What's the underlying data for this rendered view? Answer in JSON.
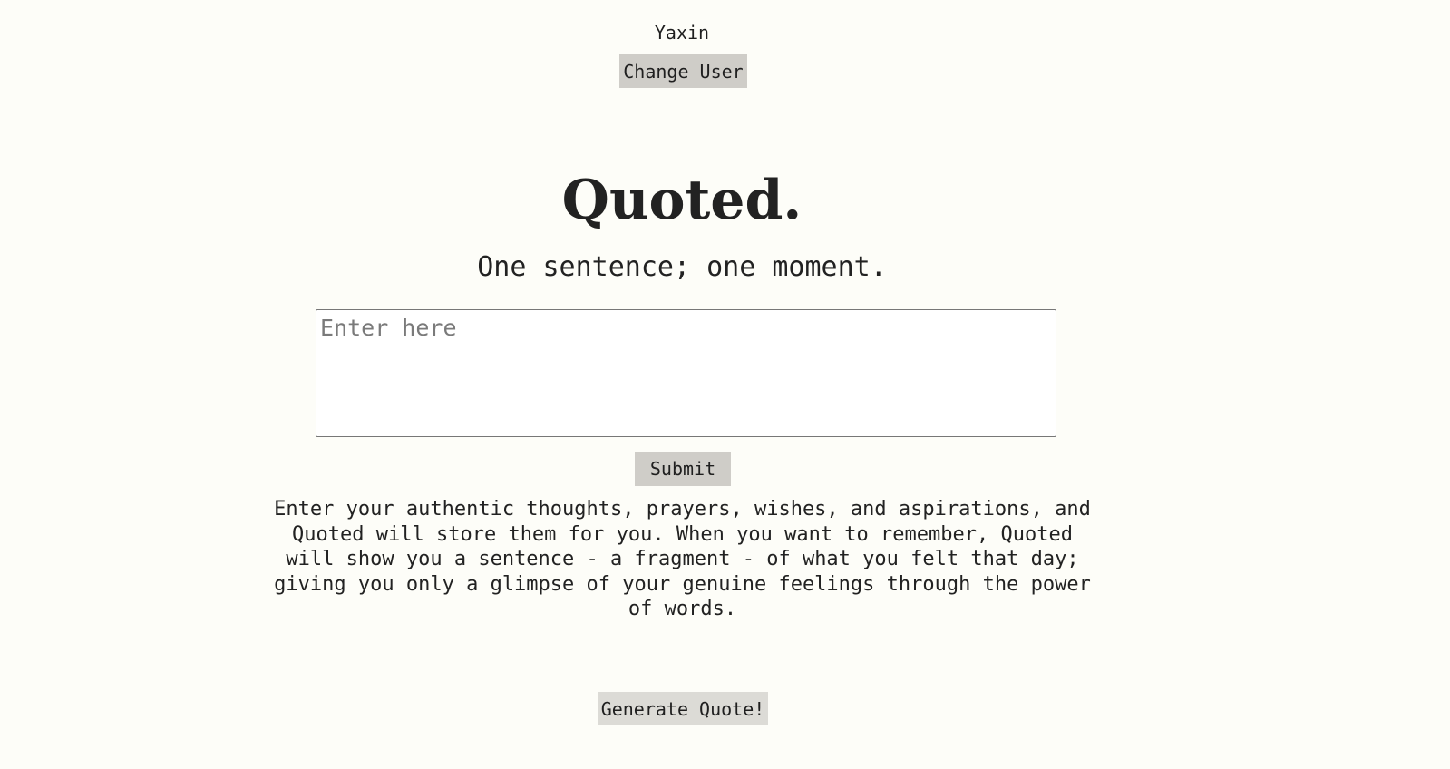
{
  "user": {
    "name": "Yaxin",
    "change_user_label": "Change User"
  },
  "header": {
    "title": "Quoted.",
    "subtitle": "One sentence; one moment."
  },
  "entry": {
    "value": "",
    "placeholder": "Enter here"
  },
  "actions": {
    "submit_label": "Submit",
    "generate_label": "Generate Quote!"
  },
  "description": "Enter your authentic thoughts, prayers, wishes, and aspirations, and Quoted will store them for you. When you want to remember, Quoted will show you a sentence - a fragment - of what you felt that day; giving you only a glimpse of your genuine feelings through the power of words.",
  "colors": {
    "background": "#fdfdf8",
    "button": "#cfcdc8",
    "generate_button": "#dcdbd6",
    "text": "#222222"
  }
}
